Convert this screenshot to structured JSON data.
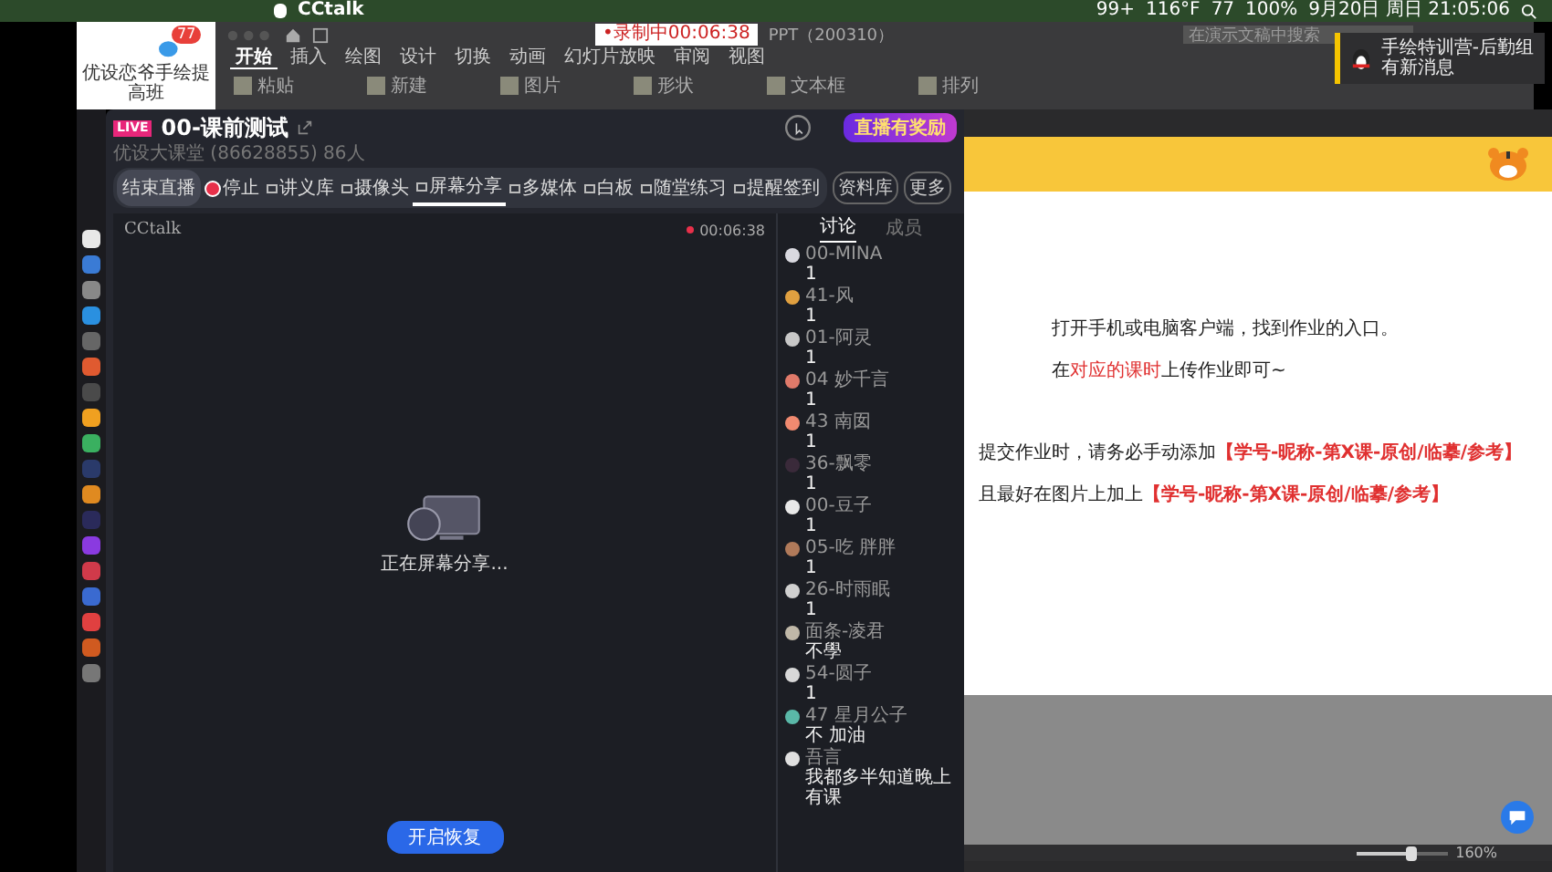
{
  "menu_bar": {
    "app": "CCtalk",
    "status": [
      "99+",
      "116°F",
      "77",
      "100%",
      "9月20日 周日 21:05:06"
    ]
  },
  "notification_card": {
    "title": "优设恋爷手绘提高班",
    "badge": "77"
  },
  "ribbon": {
    "recording": "•录制中00:06:38",
    "doc_title": "PPT（200310）",
    "search": {
      "placeholder": "在演示文稿中搜索"
    },
    "tabs": [
      {
        "label": "开始",
        "selected": true
      },
      {
        "label": "插入",
        "selected": false
      },
      {
        "label": "绘图",
        "selected": false
      },
      {
        "label": "设计",
        "selected": false
      },
      {
        "label": "切换",
        "selected": false
      },
      {
        "label": "动画",
        "selected": false
      },
      {
        "label": "幻灯片放映",
        "selected": false
      },
      {
        "label": "审阅",
        "selected": false
      },
      {
        "label": "视图",
        "selected": false
      }
    ],
    "tools": [
      {
        "label": "粘贴"
      },
      {
        "label": "新建"
      },
      {
        "label": "图片"
      },
      {
        "label": "形状"
      },
      {
        "label": "文本框"
      },
      {
        "label": "排列"
      }
    ]
  },
  "toast": {
    "title": "手绘特训营-后勤组",
    "message": "有新消息"
  },
  "cctalk": {
    "live_badge": "LIVE",
    "title": "00-课前测试",
    "subtitle": "优设大课堂 (86628855)  86人",
    "promo": "直播有奖励",
    "toolbar": [
      {
        "label": "结束直播",
        "kind": "pill",
        "selected": false
      },
      {
        "label": "停止",
        "kind": "record",
        "selected": false
      },
      {
        "label": "讲义库",
        "kind": "tool",
        "selected": false
      },
      {
        "label": "摄像头",
        "kind": "tool",
        "selected": false
      },
      {
        "label": "屏幕分享",
        "kind": "tool",
        "selected": true
      },
      {
        "label": "多媒体",
        "kind": "tool",
        "selected": false
      },
      {
        "label": "白板",
        "kind": "tool",
        "selected": false
      },
      {
        "label": "随堂练习",
        "kind": "tool",
        "selected": false
      },
      {
        "label": "提醒签到",
        "kind": "tool",
        "selected": false
      }
    ],
    "side_buttons": [
      "资料库",
      "更多"
    ],
    "stage": {
      "brand": "CCtalk",
      "timer": "00:06:38",
      "status": "正在屏幕分享...",
      "button": "开启恢复"
    },
    "chat_tabs": [
      {
        "label": "讨论",
        "selected": true
      },
      {
        "label": "成员",
        "selected": false
      }
    ],
    "messages": [
      {
        "name": "00-MINA",
        "text": "1",
        "color": "#d9d9e0"
      },
      {
        "name": "41-风",
        "text": "1",
        "color": "#e0a040"
      },
      {
        "name": "01-阿灵",
        "text": "1",
        "color": "#c8c8c8"
      },
      {
        "name": "04 妙千言",
        "text": "1",
        "color": "#e07a6a"
      },
      {
        "name": "43 南囡",
        "text": "1",
        "color": "#f08a70"
      },
      {
        "name": "36-飘零",
        "text": "1",
        "color": "#3a2a3a"
      },
      {
        "name": "00-豆子",
        "text": "1",
        "color": "#e8e8e8"
      },
      {
        "name": "05-吃 胖胖",
        "text": "1",
        "color": "#b07a5a"
      },
      {
        "name": "26-时雨眠",
        "text": "1",
        "color": "#d0d0d0"
      },
      {
        "name": "面条-凌君",
        "text": "不學",
        "color": "#c0b8a8"
      },
      {
        "name": "54-圆子",
        "text": "1",
        "color": "#d8d8d8"
      },
      {
        "name": "47 星月公子",
        "text": "不 加油",
        "color": "#5ab8a8"
      },
      {
        "name": "吾言",
        "text": "我都多半知道晚上有课",
        "color": "#e0e0e0"
      }
    ]
  },
  "slide": {
    "lines": [
      {
        "kind": "plain",
        "indent": true,
        "parts": [
          {
            "text": "打开手机或电脑客户端，找到作业的入口。",
            "emphasis": false
          }
        ]
      },
      {
        "kind": "plain",
        "indent": true,
        "parts": [
          {
            "text": "在",
            "emphasis": false
          },
          {
            "text": "对应的课时",
            "emphasis": true
          },
          {
            "text": "上传作业即可~",
            "emphasis": false
          }
        ]
      },
      {
        "kind": "gap"
      },
      {
        "kind": "plain",
        "indent": false,
        "parts": [
          {
            "text": "提交作业时，请务必手动添加",
            "emphasis": false
          },
          {
            "text": "【学号-昵称-第X课-原创/临摹/参考】",
            "emphasis": true
          }
        ]
      },
      {
        "kind": "plain",
        "indent": false,
        "parts": [
          {
            "text": "且最好在图片上加上",
            "emphasis": false
          },
          {
            "text": "【学号-昵称-第X课-原创/临摹/参考】",
            "emphasis": true
          }
        ]
      }
    ]
  },
  "status_bar": {
    "zoom": "160%",
    "level": 0.6
  }
}
